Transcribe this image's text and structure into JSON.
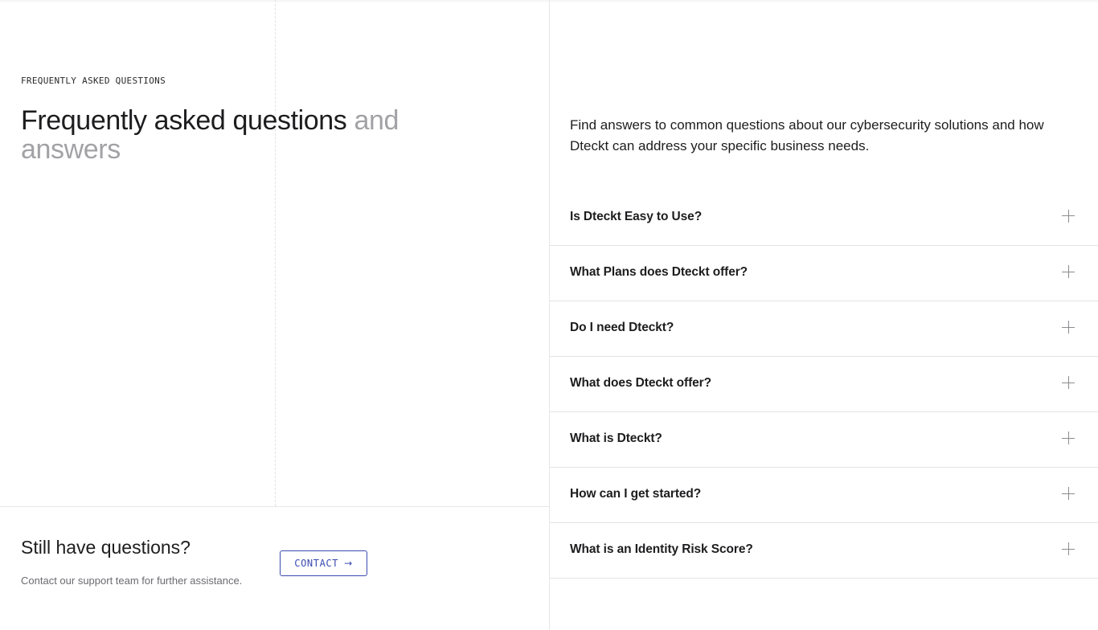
{
  "header": {
    "eyebrow": "FREQUENTLY ASKED QUESTIONS",
    "title_main": "Frequently asked questions",
    "title_muted": "and answers"
  },
  "cta": {
    "title": "Still have questions?",
    "subtitle": "Contact our support team for further assistance.",
    "button_label": "CONTACT",
    "button_icon": "arrow-right-icon"
  },
  "intro": "Find answers to common questions about our cybersecurity solutions and how Dteckt can address your specific business needs.",
  "faq": {
    "expand_icon": "plus-icon",
    "items": [
      {
        "question": "Is Dteckt Easy to Use?"
      },
      {
        "question": "What Plans does Dteckt offer?"
      },
      {
        "question": "Do I need Dteckt?"
      },
      {
        "question": "What does Dteckt offer?"
      },
      {
        "question": "What is Dteckt?"
      },
      {
        "question": "How can I get started?"
      },
      {
        "question": "What is an Identity Risk Score?"
      }
    ]
  },
  "colors": {
    "accent": "#3b4bb0",
    "text": "#1d1d1f",
    "muted": "#a2a2a6",
    "divider": "#e3e3e3"
  }
}
